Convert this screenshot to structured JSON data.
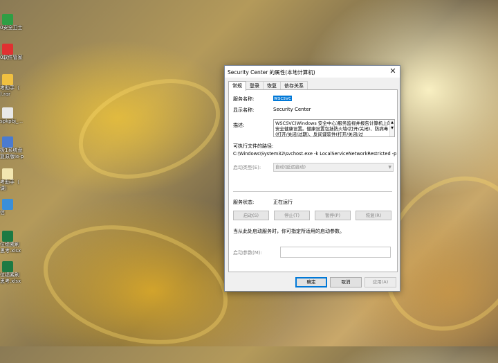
{
  "desktop": {
    "icons": [
      {
        "label": "0安全卫士",
        "icon": "security-guard-icon",
        "color": "#2f9e44"
      },
      {
        "label": "0软件管家",
        "icon": "software-manager-icon",
        "color": "#e03131"
      },
      {
        "label": "考助手（",
        "icon": "folder-icon",
        "color": "#f0c040"
      },
      {
        "label": ").rar",
        "icon": "archive-icon",
        "color": "#c0392b"
      },
      {
        "label": "spkpbj_...",
        "icon": "file-icon",
        "color": "#e8e8e8"
      },
      {
        "label": "极1系统盘",
        "icon": "system-icon",
        "color": "#4a7bd0"
      },
      {
        "label": "复原版ie-p",
        "icon": "system-icon",
        "color": "#4a7bd0"
      },
      {
        "label": "考助手（",
        "icon": "file-icon",
        "color": "#f2e6b0"
      },
      {
        "label": "课）",
        "icon": "file-icon",
        "color": "#f2e6b0"
      },
      {
        "label": "信",
        "icon": "app-icon",
        "color": "#3a8fd9"
      },
      {
        "label": "位绩素刷",
        "icon": "excel-icon",
        "color": "#1d7a43"
      },
      {
        "label": "思考.xlsx",
        "icon": "excel-icon",
        "color": "#1d7a43"
      },
      {
        "label": "位绩素刷",
        "icon": "excel-icon",
        "color": "#1d7a43"
      },
      {
        "label": "思考.xlsx",
        "icon": "excel-icon",
        "color": "#1d7a43"
      }
    ]
  },
  "dialog": {
    "title": "Security Center 的属性(本地计算机)",
    "close_glyph": "✕",
    "tabs": [
      {
        "label": "常规"
      },
      {
        "label": "登录"
      },
      {
        "label": "恢复"
      },
      {
        "label": "依存关系"
      }
    ],
    "service_name_label": "服务名称:",
    "service_name": "wscsvc",
    "display_name_label": "显示名称:",
    "display_name": "Security Center",
    "description_label": "描述:",
    "description": "WSCSVC(Windows 安全中心)服务监视并报告计算机上的安全健康设置。健康设置包括防火墙(打开/关闭)、防病毒(打开/关闭/过期)、反间谍软件(打开/关闭/过",
    "exe_path_label": "可执行文件的路径:",
    "exe_path": "C:\\Windows\\System32\\svchost.exe -k LocalServiceNetworkRestricted -p",
    "startup_type_label": "启动类型(E):",
    "startup_type_value": "自动(延迟启动)",
    "service_status_label": "服务状态:",
    "service_status": "正在运行",
    "buttons": {
      "start": "启动(S)",
      "stop": "停止(T)",
      "pause": "暂停(P)",
      "resume": "恢复(R)"
    },
    "hint": "当从此处启动服务时，你可指定所适用的启动参数。",
    "start_params_label": "启动参数(M):",
    "start_params_value": "",
    "footer": {
      "ok": "确定",
      "cancel": "取消",
      "apply": "应用(A)"
    }
  },
  "colors": {
    "accent": "#0078d7",
    "disabled_text": "#8a8a8a"
  }
}
